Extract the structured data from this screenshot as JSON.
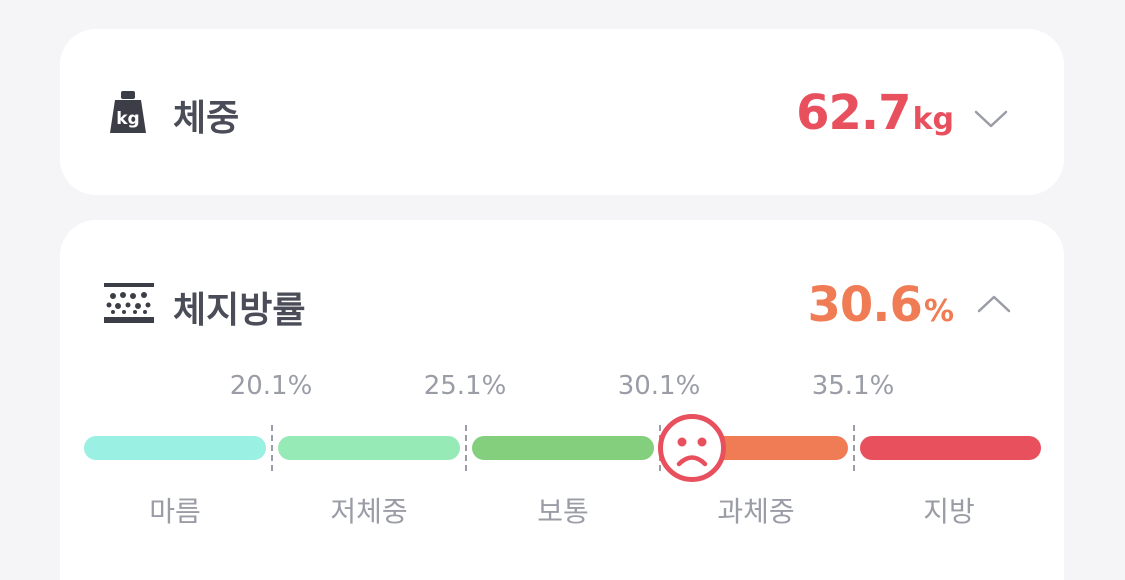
{
  "weight": {
    "title": "체중",
    "value": "62.7",
    "unit": "kg",
    "icon_label": "kg",
    "icon": "weight-kg-icon",
    "expanded": false,
    "value_color": "#e8505e"
  },
  "body_fat": {
    "title": "체지방률",
    "value": "30.6",
    "unit": "%",
    "icon": "body-fat-layers-icon",
    "expanded": true,
    "value_color": "#ef7c55",
    "indicator_icon": "sad-face-icon",
    "current_level": "과체중",
    "current_value": 30.6,
    "thresholds": [
      "20.1%",
      "25.1%",
      "30.1%",
      "35.1%"
    ],
    "categories": [
      {
        "label": "마름",
        "color": "#9af0e2"
      },
      {
        "label": "저체중",
        "color": "#96eab6"
      },
      {
        "label": "보통",
        "color": "#83cf7e"
      },
      {
        "label": "과체중",
        "color": "#ef7c55"
      },
      {
        "label": "지방",
        "color": "#e8505e"
      }
    ]
  }
}
